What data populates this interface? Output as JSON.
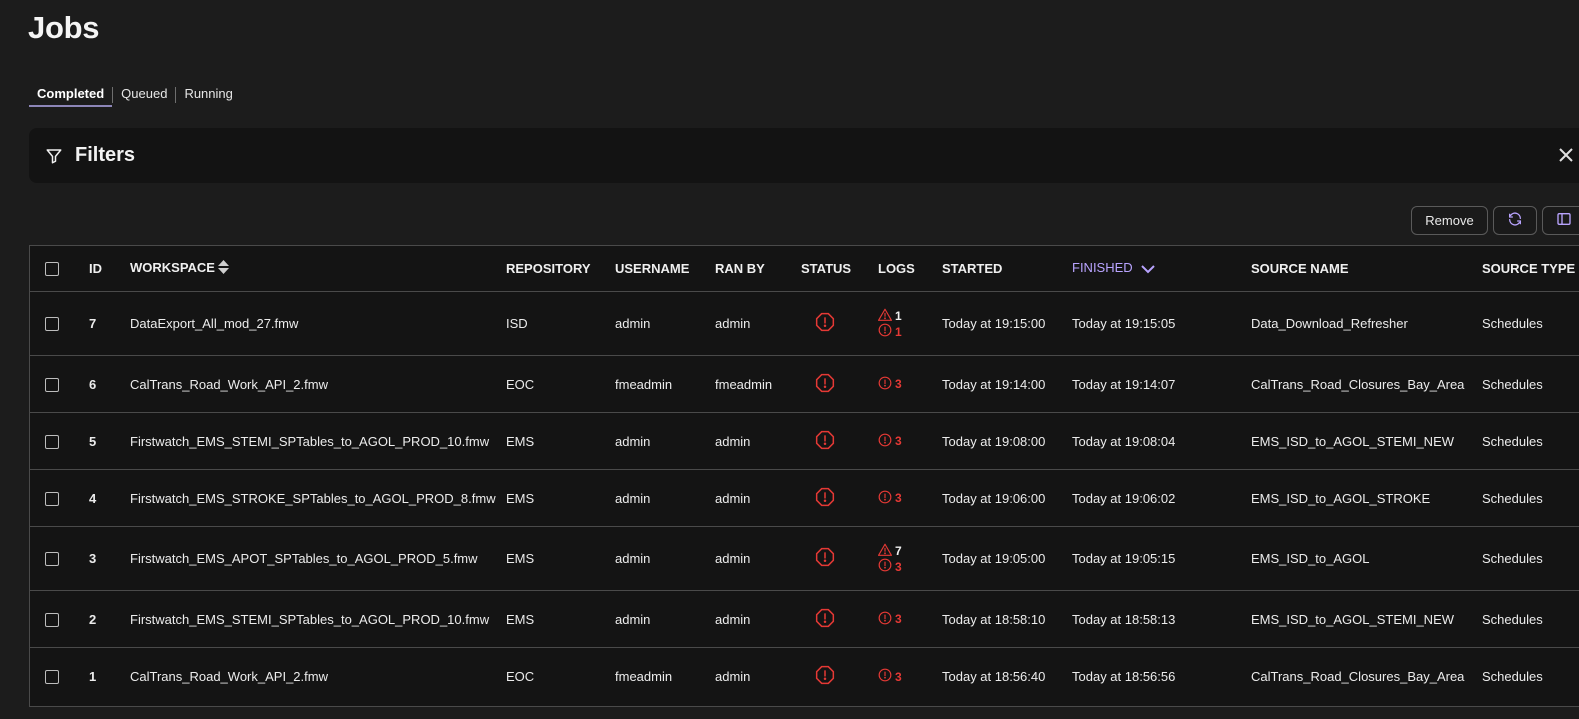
{
  "page": {
    "title": "Jobs"
  },
  "tabs": [
    {
      "label": "Completed",
      "active": true
    },
    {
      "label": "Queued",
      "active": false
    },
    {
      "label": "Running",
      "active": false
    }
  ],
  "filters": {
    "label": "Filters",
    "icon": "filter-icon"
  },
  "toolbar": {
    "remove_label": "Remove",
    "refresh_icon": "refresh-icon",
    "columns_icon": "columns-icon"
  },
  "colors": {
    "accent": "#b9a4ff",
    "error": "#e53935",
    "background": "#1c1c1c"
  },
  "table": {
    "headers": {
      "id": "ID",
      "workspace": "WORKSPACE",
      "repository": "REPOSITORY",
      "username": "USERNAME",
      "ran_by": "RAN BY",
      "status": "STATUS",
      "logs": "LOGS",
      "started": "STARTED",
      "finished": "FINISHED",
      "source_name": "SOURCE NAME",
      "source_type": "SOURCE TYPE"
    },
    "rows": [
      {
        "id": "7",
        "workspace": "DataExport_All_mod_27.fmw",
        "repository": "ISD",
        "username": "admin",
        "ran_by": "admin",
        "status": "error",
        "warnings": "1",
        "errors": "1",
        "started": "Today at 19:15:00",
        "finished": "Today at 19:15:05",
        "source_name": "Data_Download_Refresher",
        "source_type": "Schedules"
      },
      {
        "id": "6",
        "workspace": "CalTrans_Road_Work_API_2.fmw",
        "repository": "EOC",
        "username": "fmeadmin",
        "ran_by": "fmeadmin",
        "status": "error",
        "warnings": "",
        "errors": "3",
        "started": "Today at 19:14:00",
        "finished": "Today at 19:14:07",
        "source_name": "CalTrans_Road_Closures_Bay_Area",
        "source_type": "Schedules"
      },
      {
        "id": "5",
        "workspace": "Firstwatch_EMS_STEMI_SPTables_to_AGOL_PROD_10.fmw",
        "repository": "EMS",
        "username": "admin",
        "ran_by": "admin",
        "status": "error",
        "warnings": "",
        "errors": "3",
        "started": "Today at 19:08:00",
        "finished": "Today at 19:08:04",
        "source_name": "EMS_ISD_to_AGOL_STEMI_NEW",
        "source_type": "Schedules"
      },
      {
        "id": "4",
        "workspace": "Firstwatch_EMS_STROKE_SPTables_to_AGOL_PROD_8.fmw",
        "repository": "EMS",
        "username": "admin",
        "ran_by": "admin",
        "status": "error",
        "warnings": "",
        "errors": "3",
        "started": "Today at 19:06:00",
        "finished": "Today at 19:06:02",
        "source_name": "EMS_ISD_to_AGOL_STROKE",
        "source_type": "Schedules"
      },
      {
        "id": "3",
        "workspace": "Firstwatch_EMS_APOT_SPTables_to_AGOL_PROD_5.fmw",
        "repository": "EMS",
        "username": "admin",
        "ran_by": "admin",
        "status": "error",
        "warnings": "7",
        "errors": "3",
        "started": "Today at 19:05:00",
        "finished": "Today at 19:05:15",
        "source_name": "EMS_ISD_to_AGOL",
        "source_type": "Schedules"
      },
      {
        "id": "2",
        "workspace": "Firstwatch_EMS_STEMI_SPTables_to_AGOL_PROD_10.fmw",
        "repository": "EMS",
        "username": "admin",
        "ran_by": "admin",
        "status": "error",
        "warnings": "",
        "errors": "3",
        "started": "Today at 18:58:10",
        "finished": "Today at 18:58:13",
        "source_name": "EMS_ISD_to_AGOL_STEMI_NEW",
        "source_type": "Schedules"
      },
      {
        "id": "1",
        "workspace": "CalTrans_Road_Work_API_2.fmw",
        "repository": "EOC",
        "username": "fmeadmin",
        "ran_by": "admin",
        "status": "error",
        "warnings": "",
        "errors": "3",
        "started": "Today at 18:56:40",
        "finished": "Today at 18:56:56",
        "source_name": "CalTrans_Road_Closures_Bay_Area",
        "source_type": "Schedules"
      }
    ]
  }
}
